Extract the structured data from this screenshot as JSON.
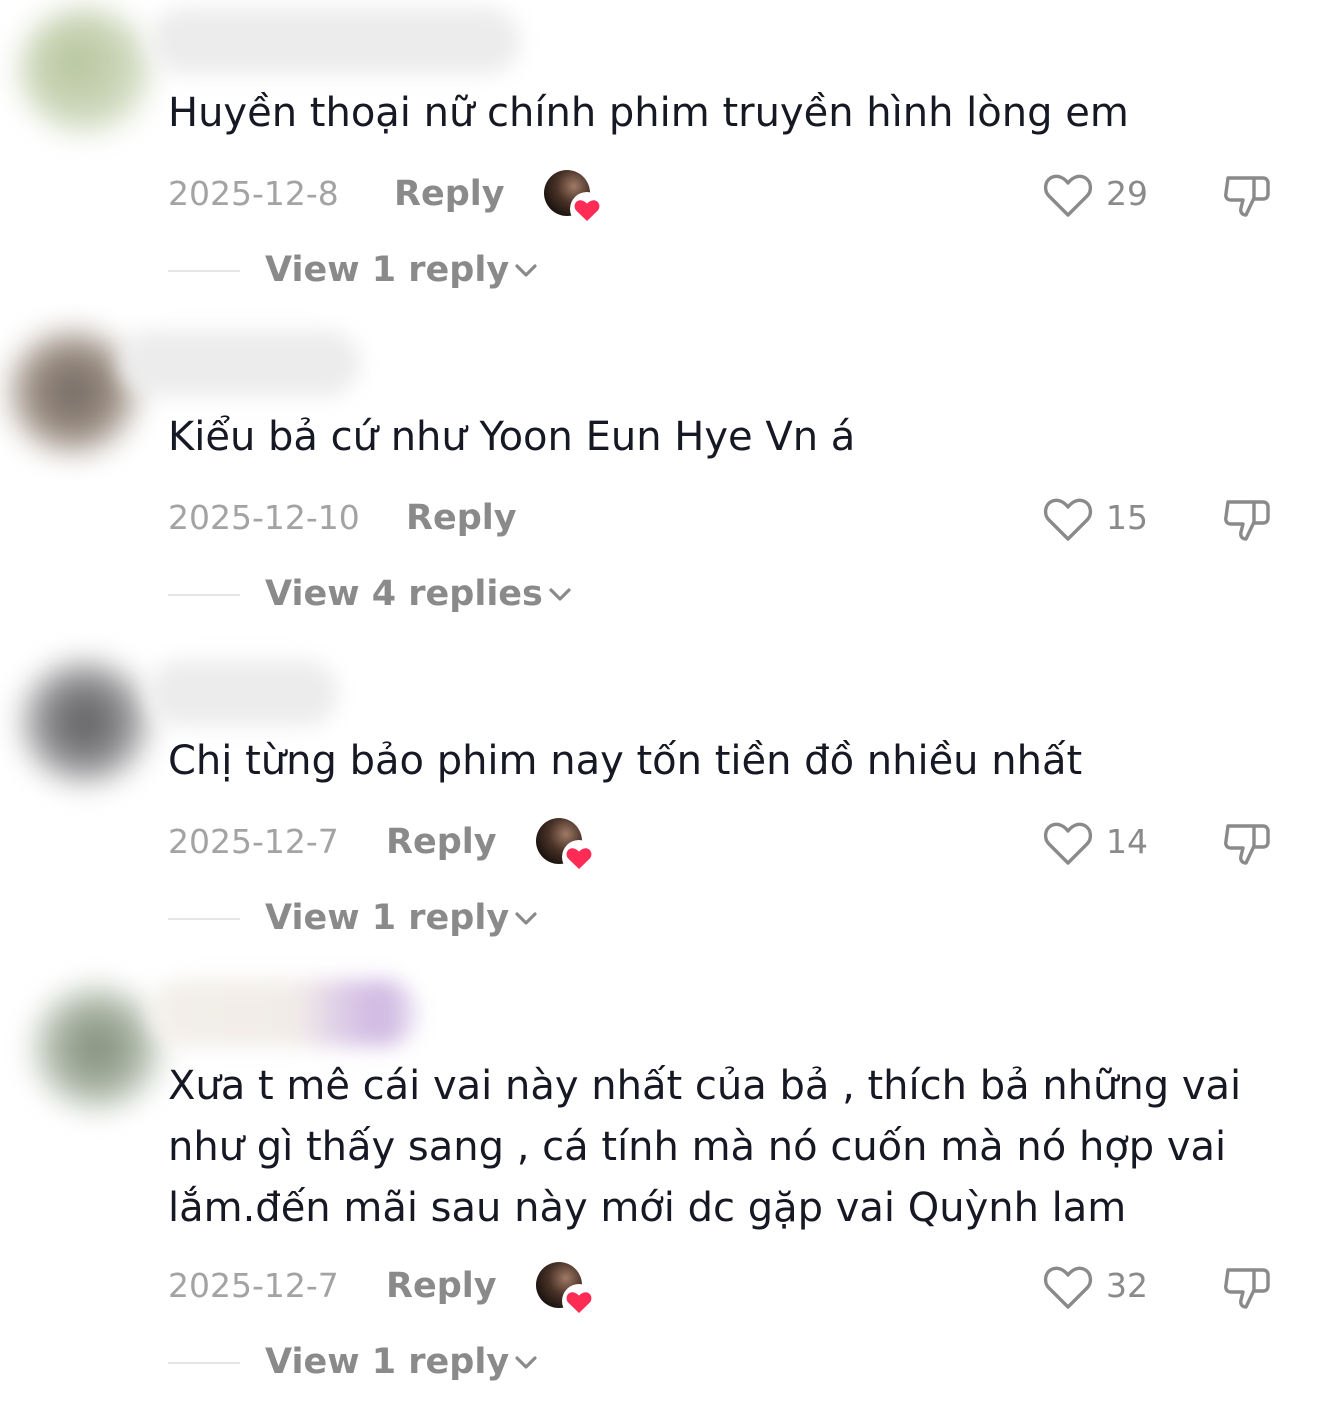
{
  "comments": [
    {
      "text": "Huyền thoại nữ chính phim truyền hình lòng em",
      "date": "2025-12-8",
      "reply_label": "Reply",
      "liked_by_creator": true,
      "likes": "29",
      "view_replies_label": "View 1 reply"
    },
    {
      "text": "Kiểu bả cứ như Yoon Eun Hye Vn á",
      "date": "2025-12-10",
      "reply_label": "Reply",
      "liked_by_creator": false,
      "likes": "15",
      "view_replies_label": "View 4 replies"
    },
    {
      "text": "Chị từng bảo phim nay tốn tiền đồ nhiều nhất",
      "date": "2025-12-7",
      "reply_label": "Reply",
      "liked_by_creator": true,
      "likes": "14",
      "view_replies_label": "View 1 reply"
    },
    {
      "text": "Xưa t mê cái vai này nhất của bả , thích bả những vai\nnhư gì thấy sang , cá tính mà nó cuốn mà nó hợp vai\nlắm.đến mãi sau này mới dc gặp vai Quỳnh lam",
      "date": "2025-12-7",
      "reply_label": "Reply",
      "liked_by_creator": true,
      "likes": "32",
      "view_replies_label": "View 1 reply"
    }
  ],
  "icons": {
    "like": "heart-outline-icon",
    "dislike": "thumbs-down-icon",
    "creator_like_badge": "red-heart-icon",
    "expand": "chevron-down-icon"
  },
  "colors": {
    "text_primary": "#161823",
    "text_secondary": "#8a8a8a",
    "date": "#a3a3a3",
    "creator_heart": "#fe2c55",
    "background": "#ffffff"
  }
}
